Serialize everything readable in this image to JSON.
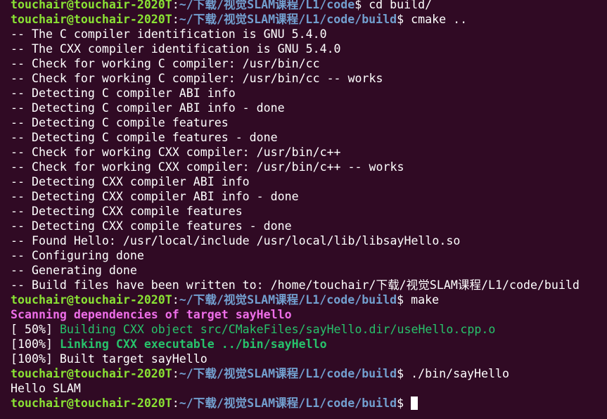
{
  "prompt": {
    "user_host": "touchair@touchair-2020T",
    "sep": ":",
    "dollar": "$",
    "path_parent": "~/下载/视觉SLAM课程/L1/code",
    "path_build": "~/下载/视觉SLAM课程/L1/code/build"
  },
  "commands": {
    "cd": " cd build/",
    "cmake": " cmake ..",
    "make": " make",
    "run": " ./bin/sayHello",
    "current": " "
  },
  "cmake_output": [
    "-- The C compiler identification is GNU 5.4.0",
    "-- The CXX compiler identification is GNU 5.4.0",
    "-- Check for working C compiler: /usr/bin/cc",
    "-- Check for working C compiler: /usr/bin/cc -- works",
    "-- Detecting C compiler ABI info",
    "-- Detecting C compiler ABI info - done",
    "-- Detecting C compile features",
    "-- Detecting C compile features - done",
    "-- Check for working CXX compiler: /usr/bin/c++",
    "-- Check for working CXX compiler: /usr/bin/c++ -- works",
    "-- Detecting CXX compiler ABI info",
    "-- Detecting CXX compiler ABI info - done",
    "-- Detecting CXX compile features",
    "-- Detecting CXX compile features - done",
    "-- Found Hello: /usr/local/include /usr/local/lib/libsayHello.so",
    "-- Configuring done",
    "-- Generating done",
    "-- Build files have been written to: /home/touchair/下载/视觉SLAM课程/L1/code/build"
  ],
  "make_output": {
    "scanning": "Scanning dependencies of target sayHello",
    "step1_prefix": "[ 50%] ",
    "step1_text": "Building CXX object src/CMakeFiles/sayHello.dir/useHello.cpp.o",
    "step2_prefix": "[100%] ",
    "step2_text": "Linking CXX executable ../bin/sayHello",
    "step3": "[100%] Built target sayHello"
  },
  "program_output": "Hello SLAM",
  "colors": {
    "background": "#300a24",
    "user_host": "#8ae234",
    "path": "#729fcf",
    "text": "#ffffff",
    "magenta": "#ee6ee8",
    "green": "#27c26b"
  }
}
